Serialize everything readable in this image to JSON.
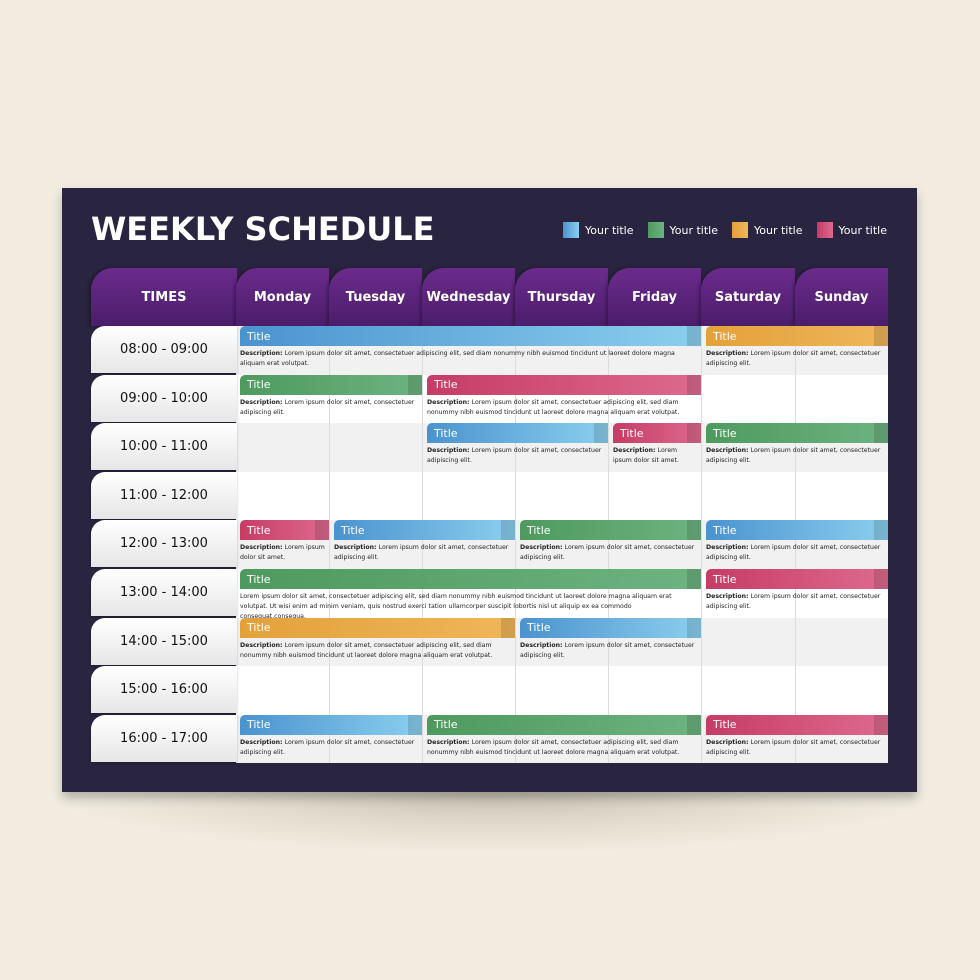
{
  "header": {
    "title": "WEEKLY SCHEDULE"
  },
  "legend": [
    {
      "label": "Your title",
      "color": "#6cb4e4"
    },
    {
      "label": "Your title",
      "color": "#5ea56f"
    },
    {
      "label": "Your title",
      "color": "#e9ab48"
    },
    {
      "label": "Your title",
      "color": "#d44f79"
    }
  ],
  "columns": {
    "times": "TIMES",
    "days": [
      "Monday",
      "Tuesday",
      "Wednesday",
      "Thursday",
      "Friday",
      "Saturday",
      "Sunday"
    ]
  },
  "times": [
    "08:00 - 09:00",
    "09:00 - 10:00",
    "10:00 - 11:00",
    "11:00 - 12:00",
    "12:00 - 13:00",
    "13:00 - 14:00",
    "14:00 - 15:00",
    "15:00 - 16:00",
    "16:00 - 17:00"
  ],
  "events": [
    {
      "row": 0,
      "start": 0,
      "span": 5,
      "color": "blue",
      "title": "Title",
      "label": "Description:",
      "text": "Lorem ipsum dolor sit amet, consectetuer adipiscing elit, sed diam nonummy nibh euismod tincidunt ut laoreet dolore magna aliquam erat volutpat."
    },
    {
      "row": 0,
      "start": 5,
      "span": 2,
      "color": "orange",
      "title": "Title",
      "label": "Description:",
      "text": "Lorem ipsum dolor sit amet, consectetuer adipiscing elit."
    },
    {
      "row": 1,
      "start": 0,
      "span": 2,
      "color": "green",
      "title": "Title",
      "label": "Description:",
      "text": "Lorem ipsum dolor sit amet, consectetuer adipiscing elit."
    },
    {
      "row": 1,
      "start": 2,
      "span": 3,
      "color": "pink",
      "title": "Title",
      "label": "Description:",
      "text": "Lorem ipsum dolor sit amet, consectetuer adipiscing elit, sed diam nonummy nibh euismod tincidunt ut laoreet dolore magna aliquam erat volutpat."
    },
    {
      "row": 2,
      "start": 2,
      "span": 2,
      "color": "blue",
      "title": "Title",
      "label": "Description:",
      "text": "Lorem ipsum dolor sit amet, consectetuer adipiscing elit."
    },
    {
      "row": 2,
      "start": 4,
      "span": 1,
      "color": "pink",
      "title": "Title",
      "label": "Description:",
      "text": "Lorem ipsum dolor sit amet."
    },
    {
      "row": 2,
      "start": 5,
      "span": 2,
      "color": "green",
      "title": "Title",
      "label": "Description:",
      "text": "Lorem ipsum dolor sit amet, consectetuer adipiscing elit."
    },
    {
      "row": 4,
      "start": 0,
      "span": 1,
      "color": "pink",
      "title": "Title",
      "label": "Description:",
      "text": "Lorem ipsum dolor sit amet."
    },
    {
      "row": 4,
      "start": 1,
      "span": 2,
      "color": "blue",
      "title": "Title",
      "label": "Description:",
      "text": "Lorem ipsum dolor sit amet, consectetuer adipiscing elit."
    },
    {
      "row": 4,
      "start": 3,
      "span": 2,
      "color": "green",
      "title": "Title",
      "label": "Description:",
      "text": "Lorem ipsum dolor sit amet, consectetuer adipiscing elit."
    },
    {
      "row": 4,
      "start": 5,
      "span": 2,
      "color": "blue",
      "title": "Title",
      "label": "Description:",
      "text": "Lorem ipsum dolor sit amet, consectetuer adipiscing elit."
    },
    {
      "row": 5,
      "start": 0,
      "span": 5,
      "color": "green",
      "title": "Title",
      "label": "",
      "text": "Lorem ipsum dolor sit amet, consectetuer adipiscing elit, sed diam nonummy nibh euismod tincidunt ut laoreet dolore magna aliquam erat volutpat. Ut wisi enim ad minim veniam, quis nostrud exerci tation ullamcorper suscipit lobortis nisl ut aliquip ex ea commodo consequat.consequa."
    },
    {
      "row": 5,
      "start": 5,
      "span": 2,
      "color": "pink",
      "title": "Title",
      "label": "Description:",
      "text": "Lorem ipsum dolor sit amet, consectetuer adipiscing elit."
    },
    {
      "row": 6,
      "start": 0,
      "span": 3,
      "color": "orange",
      "title": "Title",
      "label": "Description:",
      "text": "Lorem ipsum dolor sit amet, consectetuer adipiscing elit, sed diam nonummy nibh euismod tincidunt ut laoreet dolore magna aliquam erat volutpat."
    },
    {
      "row": 6,
      "start": 3,
      "span": 2,
      "color": "blue",
      "title": "Title",
      "label": "Description:",
      "text": "Lorem ipsum dolor sit amet, consectetuer adipiscing elit."
    },
    {
      "row": 8,
      "start": 0,
      "span": 2,
      "color": "blue",
      "title": "Title",
      "label": "Description:",
      "text": "Lorem ipsum dolor sit amet, consectetuer adipiscing elit."
    },
    {
      "row": 8,
      "start": 2,
      "span": 3,
      "color": "green",
      "title": "Title",
      "label": "Description:",
      "text": "Lorem ipsum dolor sit amet, consectetuer adipiscing elit, sed diam nonummy nibh euismod tincidunt ut laoreet dolore magna aliquam erat volutpat."
    },
    {
      "row": 8,
      "start": 5,
      "span": 2,
      "color": "pink",
      "title": "Title",
      "label": "Description:",
      "text": "Lorem ipsum dolor sit amet, consectetuer adipiscing elit."
    }
  ]
}
